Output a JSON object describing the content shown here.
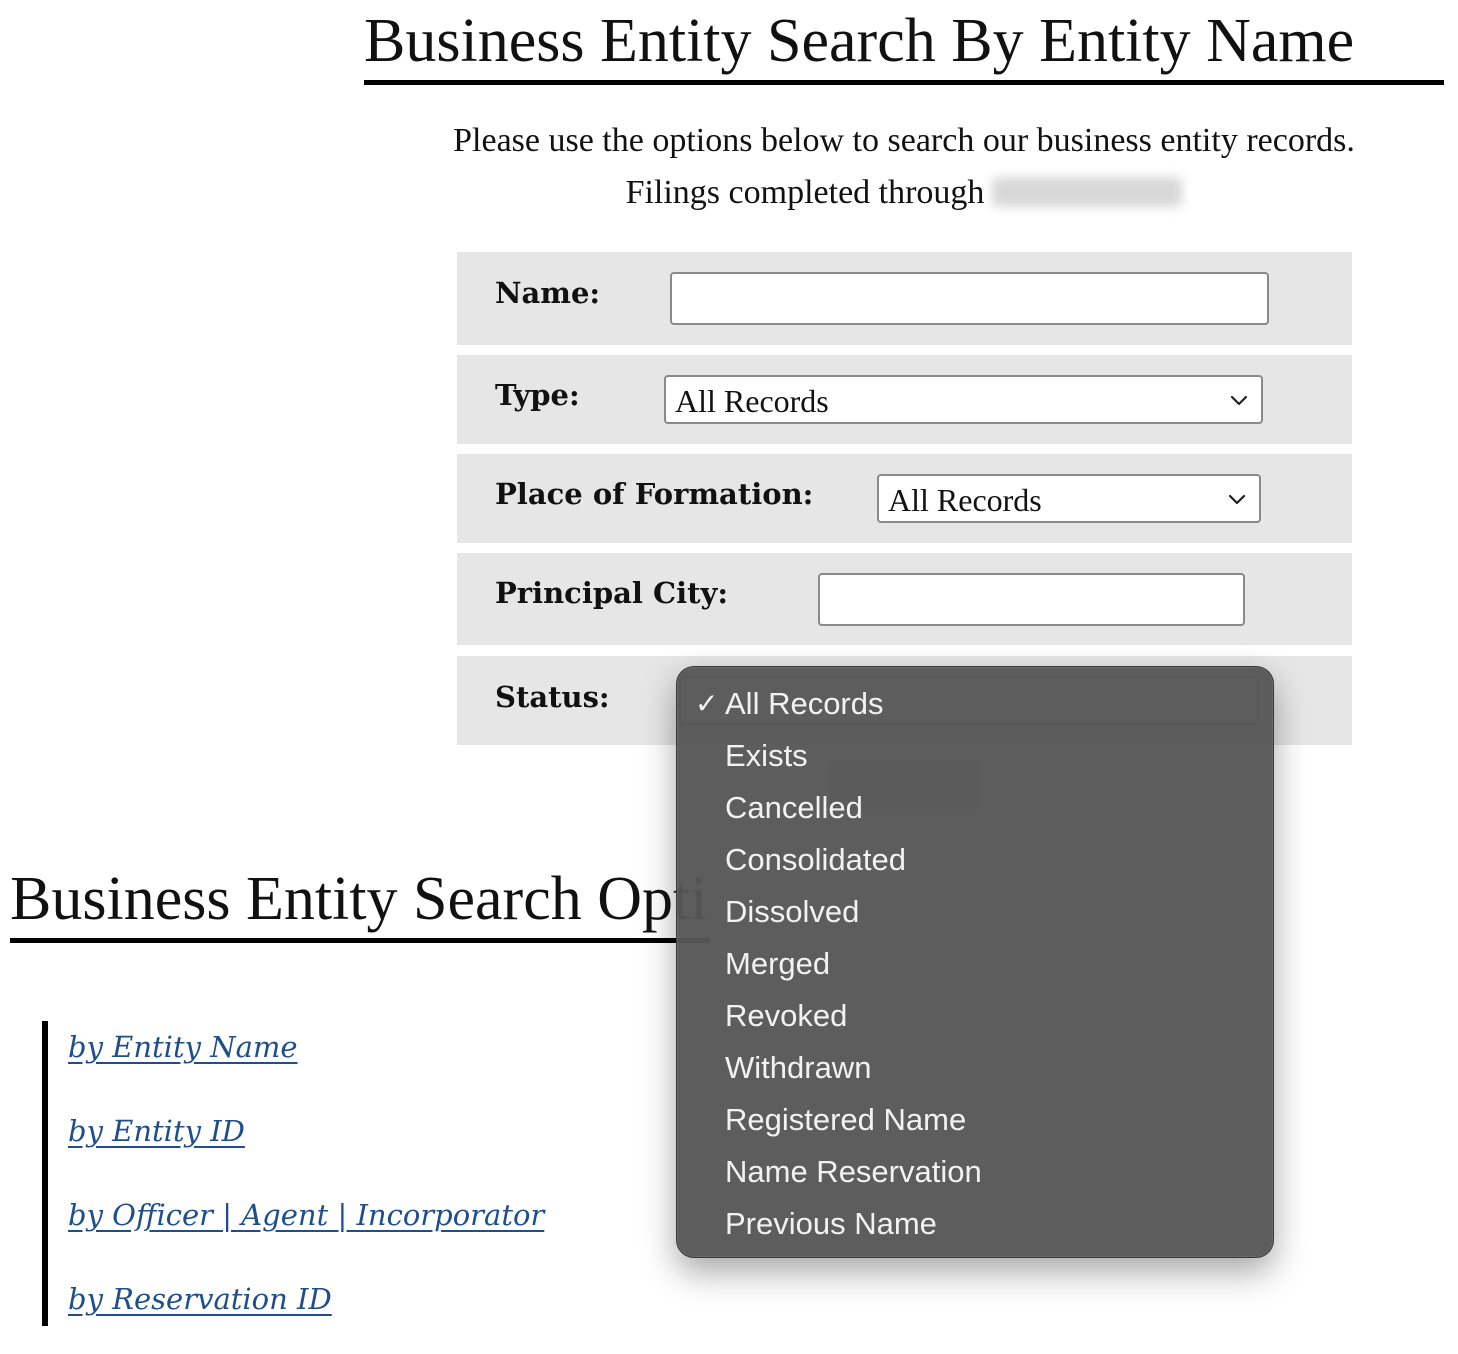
{
  "headings": {
    "top": "Business Entity Search By Entity Name",
    "bottom": "Business Entity Search Options"
  },
  "intro": {
    "line1": "Please use the options below to search our business entity records.",
    "line2": "Filings completed through"
  },
  "form": {
    "name_label": "Name:",
    "name_value": "",
    "type_label": "Type:",
    "type_value": "All Records",
    "place_label": "Place of Formation:",
    "place_value": "All Records",
    "city_label": "Principal City:",
    "city_value": "",
    "status_label": "Status:"
  },
  "status_dropdown": {
    "selected": "All Records",
    "check_glyph": "✓",
    "options": [
      "All Records",
      "Exists",
      "Cancelled",
      "Consolidated",
      "Dissolved",
      "Merged",
      "Revoked",
      "Withdrawn",
      "Registered Name",
      "Name Reservation",
      "Previous Name"
    ]
  },
  "links": [
    "by Entity Name",
    "by Entity ID",
    "by Officer | Agent | Incorporator",
    "by Reservation ID"
  ],
  "colors": {
    "row_background": "#e6e6e6",
    "link": "#1f4e8c",
    "menu_background": "#565656",
    "menu_text": "#f2f2f2"
  }
}
